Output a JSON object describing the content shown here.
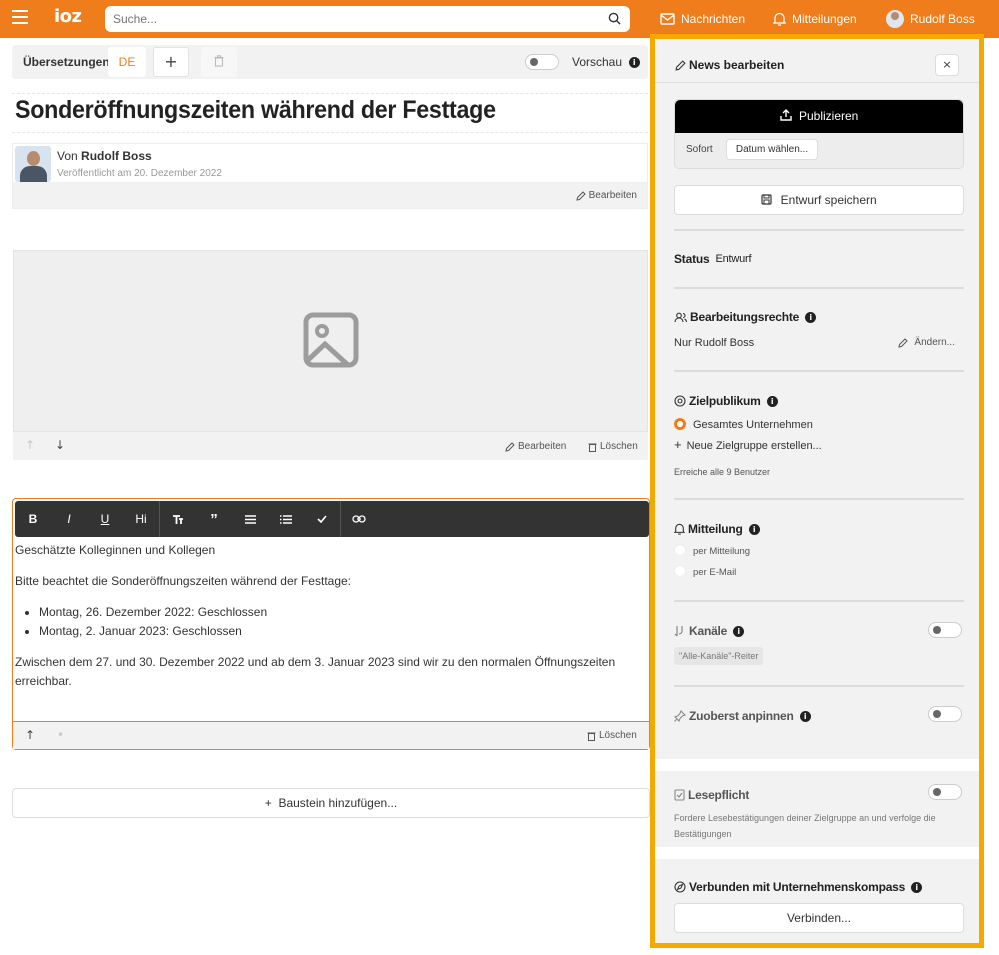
{
  "topbar": {
    "logo_text": "ioz",
    "search_placeholder": "Suche...",
    "nachrichten": "Nachrichten",
    "mitteilungen": "Mitteilungen",
    "user_name": "Rudolf Boss",
    "accent_color": "#ef7d1b"
  },
  "translations": {
    "label": "Übersetzungen",
    "active_lang": "DE",
    "add_label": "+",
    "preview_label": "Vorschau"
  },
  "article": {
    "title": "Sonderöffnungszeiten während der Festtage",
    "author_prefix": "Von",
    "author_name": "Rudolf Boss",
    "published": "Veröffentlicht am 20. Dezember 2022",
    "edit_label": "Bearbeiten"
  },
  "image_block": {
    "edit_label": "Bearbeiten",
    "delete_label": "Löschen"
  },
  "editor": {
    "toolbar": [
      "B",
      "I",
      "U",
      "Hi"
    ],
    "paragraph1": "Geschätzte Kolleginnen und Kollegen",
    "paragraph2": "Bitte beachtet die Sonderöffnungszeiten während der Festtage:",
    "list": [
      "Montag, 26. Dezember 2022: Geschlossen",
      "Montag, 2. Januar 2023: Geschlossen"
    ],
    "paragraph3": "Zwischen dem 27. und 30. Dezember 2022 und ab dem 3. Januar 2023 sind wir zu den normalen Öffnungszeiten erreichbar.",
    "delete_label": "Löschen"
  },
  "add_block_label": "Baustein hinzufügen...",
  "panel": {
    "title": "News bearbeiten",
    "close": "×",
    "publish": "Publizieren",
    "sofort": "Sofort",
    "date_select": "Datum wählen...",
    "save_draft": "Entwurf speichern",
    "status_label": "Status",
    "status_value": "Entwurf",
    "rights_label": "Bearbeitungsrechte",
    "rights_value": "Nur Rudolf Boss",
    "rights_change": "Ändern...",
    "audience_label": "Zielpublikum",
    "audience_option": "Gesamtes Unternehmen",
    "audience_new": "Neue Zielgruppe erstellen...",
    "audience_reach": "Erreiche alle 9 Benutzer",
    "notify_label": "Mitteilung",
    "notify_options": [
      "per Mitteilung",
      "per E-Mail"
    ],
    "channels_label": "Kanäle",
    "channels_chip": "\"Alle-Kanäle\"-Reiter",
    "pin_label": "Zuoberst anpinnen",
    "read_label": "Lesepflicht",
    "read_desc": "Fordere Lesebestätigungen deiner Zielgruppe an und verfolge die Bestätigungen",
    "compass_label": "Verbunden mit Unternehmenskompass",
    "connect": "Verbinden...",
    "highlight_color": "#f5a800"
  }
}
